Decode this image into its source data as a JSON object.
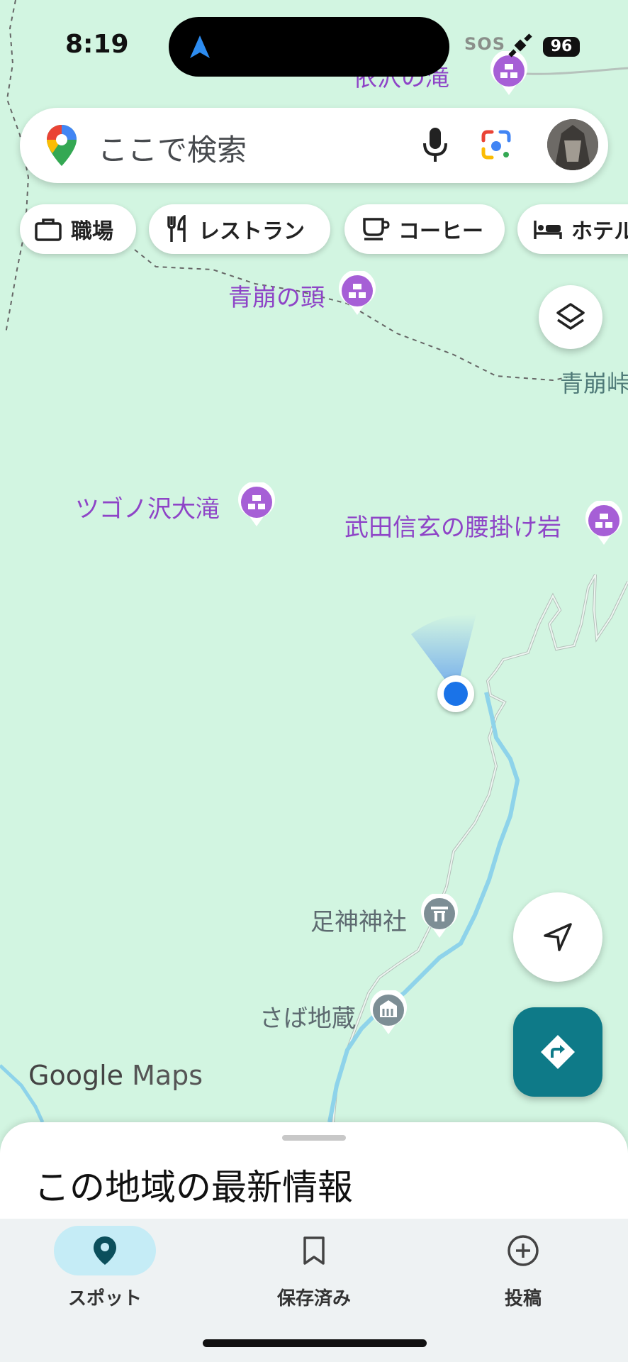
{
  "status_bar": {
    "time": "8:19",
    "sos": "SOS",
    "battery": "96"
  },
  "search": {
    "placeholder": "ここで検索"
  },
  "chips": [
    {
      "label": "職場",
      "icon": "briefcase-icon"
    },
    {
      "label": "レストラン",
      "icon": "restaurant-icon"
    },
    {
      "label": "コーヒー",
      "icon": "coffee-icon"
    },
    {
      "label": "ホテル",
      "icon": "hotel-icon"
    }
  ],
  "map": {
    "pois": [
      {
        "name": "依沢の滝",
        "icon": "waterfall-icon"
      },
      {
        "name": "青崩の頭",
        "icon": "landmark-icon"
      },
      {
        "name": "青崩峠",
        "icon": "pass-label"
      },
      {
        "name": "ツゴノ沢大滝",
        "icon": "waterfall-icon"
      },
      {
        "name": "武田信玄の腰掛け岩",
        "icon": "landmark-icon"
      },
      {
        "name": "足神神社",
        "icon": "shrine-icon"
      },
      {
        "name": "さば地蔵",
        "icon": "temple-icon"
      }
    ],
    "attribution": {
      "google": "Google",
      "maps": "Maps"
    },
    "colors": {
      "land": "#d2f5e1",
      "river": "#8ed3ea",
      "poi": "#9b59d0",
      "accent": "#0e7a88",
      "location": "#1a73e8"
    }
  },
  "sheet": {
    "title": "この地域の最新情報"
  },
  "nav": [
    {
      "label": "スポット",
      "icon": "place-pin-icon",
      "active": true
    },
    {
      "label": "保存済み",
      "icon": "bookmark-icon",
      "active": false
    },
    {
      "label": "投稿",
      "icon": "add-circle-icon",
      "active": false
    }
  ]
}
